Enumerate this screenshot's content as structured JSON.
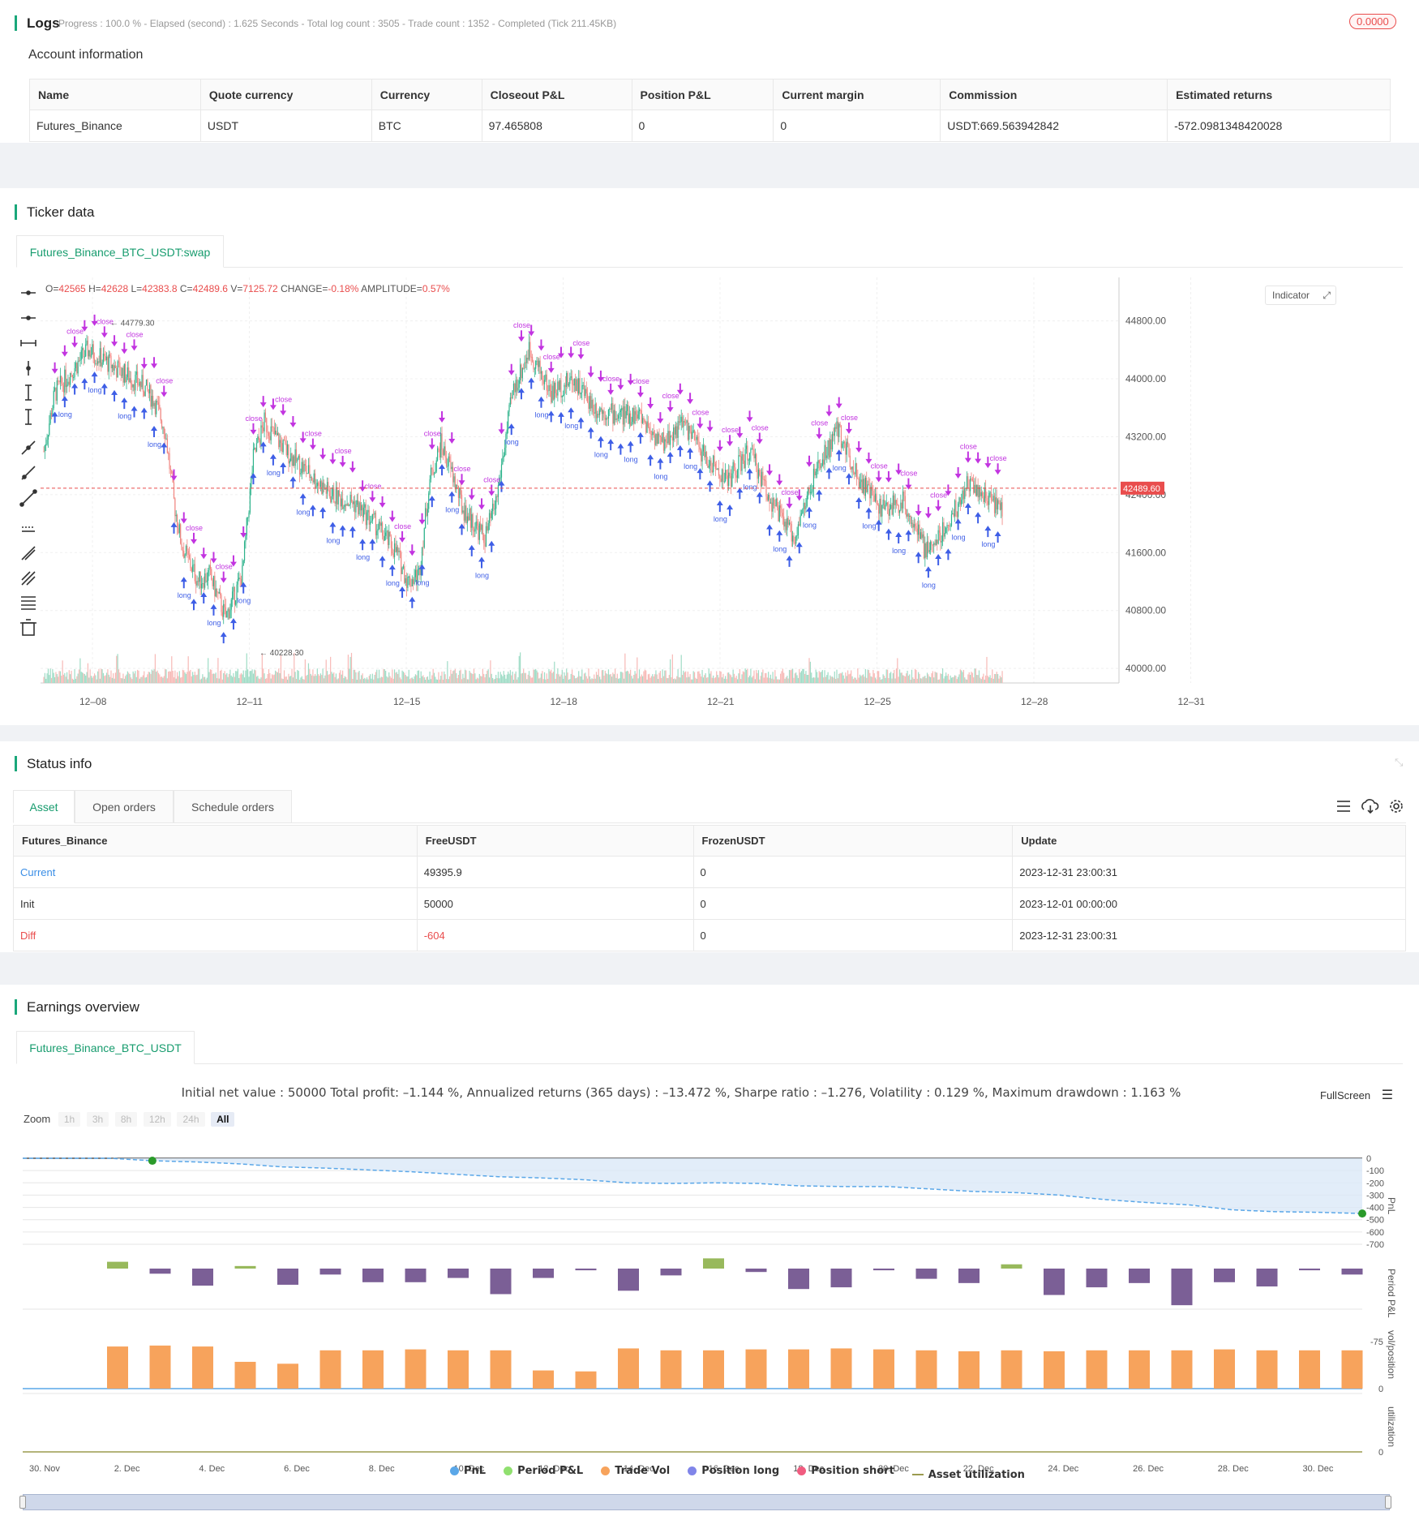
{
  "logs": {
    "title": "Logs",
    "status": "Progress : 100.0 % - Elapsed (second) : 1.625  Seconds - Total log count : 3505 - Trade count : 1352 - Completed (Tick 211.45KB)",
    "badge": "0.0000"
  },
  "account": {
    "title": "Account information",
    "headers": [
      "Name",
      "Quote currency",
      "Currency",
      "Closeout P&L",
      "Position P&L",
      "Current margin",
      "Commission",
      "Estimated returns"
    ],
    "row": [
      "Futures_Binance",
      "USDT",
      "BTC",
      "97.465808",
      "0",
      "0",
      "USDT:669.563942842",
      "-572.0981348420028"
    ]
  },
  "ticker": {
    "title": "Ticker data",
    "tab": "Futures_Binance_BTC_USDT:swap",
    "ohlc": {
      "o_label": "O=",
      "o": "42565",
      "h_label": "H=",
      "h": "42628",
      "l_label": "L=",
      "l": "42383.8",
      "c_label": "C=",
      "c": "42489.6",
      "v_label": "V=",
      "v": "7125.72",
      "chg_label": "CHANGE=",
      "chg": "-0.18%",
      "amp_label": "AMPLITUDE=",
      "amp": "0.57%"
    },
    "indicator_btn": "Indicator",
    "current_price": "42489.60",
    "high_mark": "44779.30",
    "low_mark": "40228.30",
    "marker_close": "close",
    "marker_long": "long",
    "price_ticks": [
      "44800.00",
      "44000.00",
      "43200.00",
      "42400.00",
      "41600.00",
      "40800.00",
      "40000.00"
    ],
    "date_ticks": [
      "12–08",
      "12–11",
      "12–15",
      "12–18",
      "12–21",
      "12–25",
      "12–28",
      "12–31"
    ]
  },
  "status": {
    "title": "Status info",
    "tabs": [
      "Asset",
      "Open orders",
      "Schedule orders"
    ],
    "headers": [
      "Futures_Binance",
      "FreeUSDT",
      "FrozenUSDT",
      "Update"
    ],
    "rows": [
      [
        "Current",
        "49395.9",
        "0",
        "2023-12-31 23:00:31"
      ],
      [
        "Init",
        "50000",
        "0",
        "2023-12-01 00:00:00"
      ],
      [
        "Diff",
        "-604",
        "0",
        "2023-12-31 23:00:31"
      ]
    ],
    "colors": {
      "current": "#3a8ee6",
      "diff": "#e94d4d"
    }
  },
  "earnings": {
    "title": "Earnings overview",
    "tab": "Futures_Binance_BTC_USDT",
    "summary": "Initial net value : 50000 Total profit: –1.144 %, Annualized returns (365 days) : –13.472 %, Sharpe ratio : –1.276, Volatility : 0.129 %, Maximum drawdown : 1.163 %",
    "fullscreen": "FullScreen",
    "zoom_label": "Zoom",
    "zoom_options": [
      "1h",
      "3h",
      "8h",
      "12h",
      "24h",
      "All"
    ],
    "pnl_ticks": [
      "0",
      "-100",
      "-200",
      "-300",
      "-400",
      "-500",
      "-600",
      "-700"
    ],
    "period_ticks": [
      "-75"
    ],
    "vol_ticks": [
      "0"
    ],
    "util_ticks": [
      "0"
    ],
    "axis_titles": [
      "PnL",
      "Period P&L",
      "vol/position",
      "utilization"
    ],
    "x_ticks": [
      "30. Nov",
      "2. Dec",
      "4. Dec",
      "6. Dec",
      "8. Dec",
      "10. Dec",
      "12. Dec",
      "14. Dec",
      "16. Dec",
      "18. Dec",
      "20. Dec",
      "22. Dec",
      "24. Dec",
      "26. Dec",
      "28. Dec",
      "30. Dec"
    ],
    "legend": [
      {
        "label": "PnL",
        "color": "#5aa7e8"
      },
      {
        "label": "Period P&L",
        "color": "#90e06f"
      },
      {
        "label": "Trade Vol",
        "color": "#f7a35c"
      },
      {
        "label": "Position long",
        "color": "#8085e9"
      },
      {
        "label": "Position short",
        "color": "#f15c80"
      },
      {
        "label": "Asset utilization",
        "color": "#9b9b4f"
      }
    ]
  },
  "chart_data": [
    {
      "type": "line",
      "title": "",
      "ylabel": "PnL",
      "ylim": [
        -700,
        0
      ],
      "x": [
        "30. Nov",
        "1. Dec",
        "2. Dec",
        "3. Dec",
        "4. Dec",
        "5. Dec",
        "6. Dec",
        "7. Dec",
        "8. Dec",
        "9. Dec",
        "10. Dec",
        "11. Dec",
        "12. Dec",
        "13. Dec",
        "14. Dec",
        "15. Dec",
        "16. Dec",
        "17. Dec",
        "18. Dec",
        "19. Dec",
        "20. Dec",
        "21. Dec",
        "22. Dec",
        "23. Dec",
        "24. Dec",
        "25. Dec",
        "26. Dec",
        "27. Dec",
        "28. Dec",
        "29. Dec",
        "30. Dec",
        "31. Dec"
      ],
      "series": [
        {
          "name": "PnL",
          "values": [
            0,
            0,
            0,
            -20,
            -30,
            -45,
            -70,
            -80,
            -95,
            -110,
            -130,
            -150,
            -160,
            -175,
            -200,
            -205,
            -200,
            -205,
            -225,
            -230,
            -230,
            -250,
            -270,
            -280,
            -300,
            -335,
            -360,
            -380,
            -420,
            -435,
            -440,
            -450
          ]
        }
      ]
    },
    {
      "type": "bar",
      "title": "",
      "ylabel": "Period P&L",
      "categories": [
        "2. Dec",
        "3. Dec",
        "4. Dec",
        "5. Dec",
        "6. Dec",
        "7. Dec",
        "8. Dec",
        "9. Dec",
        "10. Dec",
        "11. Dec",
        "12. Dec",
        "13. Dec",
        "14. Dec",
        "15. Dec",
        "16. Dec",
        "17. Dec",
        "18. Dec",
        "19. Dec",
        "20. Dec",
        "21. Dec",
        "22. Dec",
        "23. Dec",
        "24. Dec",
        "25. Dec",
        "26. Dec",
        "27. Dec",
        "28. Dec",
        "29. Dec",
        "30. Dec",
        "31. Dec"
      ],
      "series": [
        {
          "name": "Period P&L",
          "values": [
            8,
            -6,
            -20,
            3,
            -19,
            -7,
            -16,
            -16,
            -11,
            -30,
            -11,
            -2,
            -26,
            -8,
            12,
            -4,
            -24,
            -22,
            -2,
            -12,
            -17,
            5,
            -31,
            -22,
            -17,
            -43,
            -16,
            -21,
            -2,
            -7
          ]
        }
      ]
    },
    {
      "type": "bar",
      "title": "",
      "ylabel": "vol/position",
      "categories": [
        "2. Dec",
        "3. Dec",
        "4. Dec",
        "5. Dec",
        "6. Dec",
        "7. Dec",
        "8. Dec",
        "9. Dec",
        "10. Dec",
        "11. Dec",
        "12. Dec",
        "13. Dec",
        "14. Dec",
        "15. Dec",
        "16. Dec",
        "17. Dec",
        "18. Dec",
        "19. Dec",
        "20. Dec",
        "21. Dec",
        "22. Dec",
        "23. Dec",
        "24. Dec",
        "25. Dec",
        "26. Dec",
        "27. Dec",
        "28. Dec",
        "29. Dec",
        "30. Dec",
        "31. Dec"
      ],
      "series": [
        {
          "name": "Trade Vol",
          "values": [
            44,
            45,
            44,
            28,
            26,
            40,
            40,
            41,
            40,
            40,
            19,
            18,
            42,
            40,
            40,
            41,
            41,
            42,
            41,
            40,
            39,
            40,
            39,
            40,
            40,
            40,
            41,
            40,
            40,
            40
          ]
        }
      ]
    }
  ]
}
